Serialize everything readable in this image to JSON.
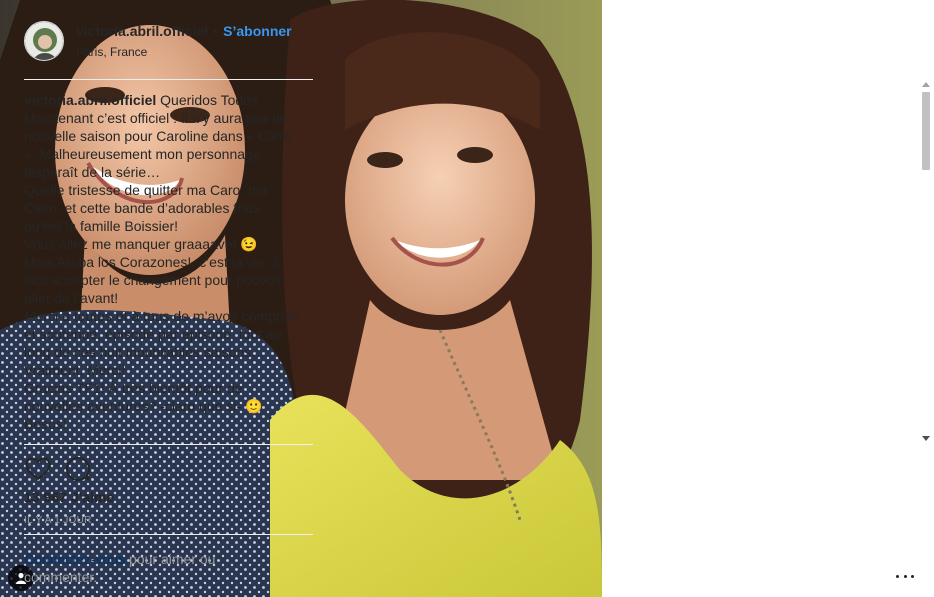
{
  "photo": {
    "user_tag_icon": "person-icon"
  },
  "header": {
    "username": "victoria.abril.officiel",
    "separator": "•",
    "follow_label": "S’abonner",
    "location": "Paris, France",
    "avatar_icon": "profile-avatar"
  },
  "caption": {
    "username": "victoria.abril.officiel",
    "text": " Queridos Todos, Maintenant c’est officiel : Il n’y aura pas de nouvelle saison pour Caroline dans « Clem ». Malheureusement mon personnage disparaît de la série…\nQuelle tristesse de quitter ma Caro, ma Clem, et cette bande d’adorables fous qu’est la famille Boissier!\nVous allez me manquer graaaave! 😉\nMais Arriba los Corazones!, c’est la vie; il faut accepter le changement pour pouvoir aller de l’avant!\nMerci à toutes et à tous de m’avoir comprise et soutenue, épisode par épisode, tout au long de ces huit inoubliables saisons… Vraiment, Merci!\nGracias TF1! À très bientôt pour de nouvelles aventures? -claro que si- 🙂\nBesos!"
  },
  "actions": {
    "like_icon": "heart-icon",
    "comment_icon": "comment-bubble-icon"
  },
  "likes": {
    "count": "13 967",
    "label": "J’aime"
  },
  "timestamp": "IL Y A 1 JOUR",
  "login": {
    "link": "Connectez-vous",
    "rest": " pour aimer ou commenter."
  },
  "more_icon": "more-options-icon",
  "colors": {
    "accent": "#3897f0",
    "link_dark": "#003569",
    "muted": "#999999",
    "text": "#262626"
  }
}
